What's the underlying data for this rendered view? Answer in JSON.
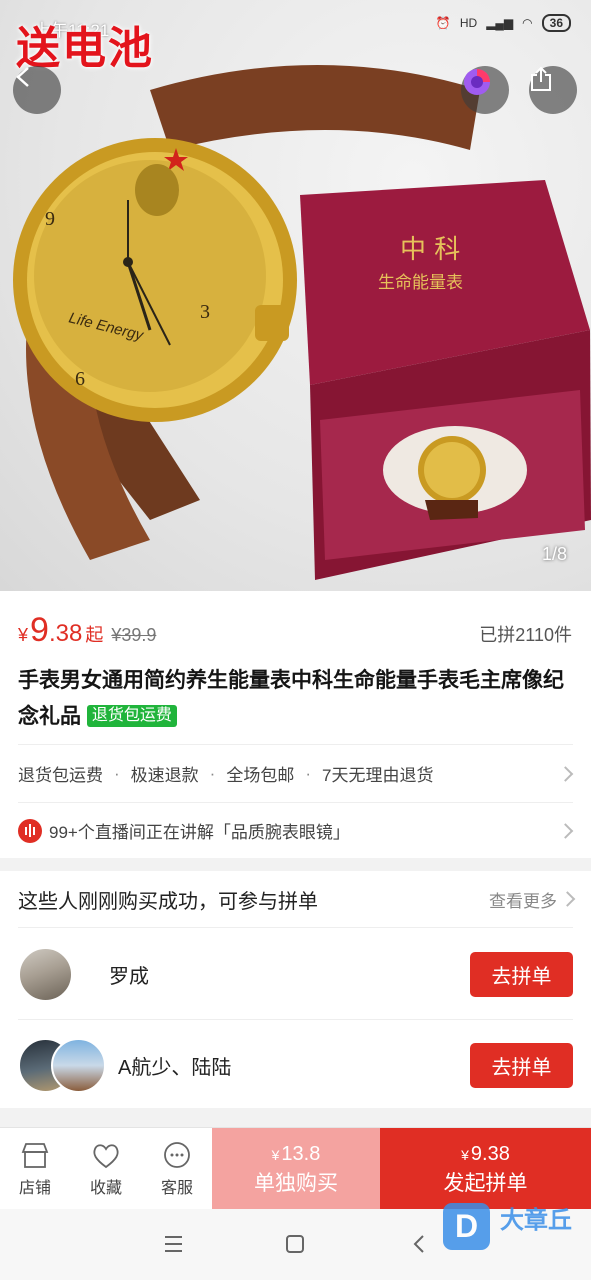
{
  "status_bar": {
    "time": "上午11:21",
    "battery": "36",
    "network": "HD"
  },
  "hero": {
    "promo_text": "送电池",
    "image_counter": "1/8",
    "dial_text": "Life Energy",
    "box_line1": "中 科",
    "box_line2": "生命能量表"
  },
  "product": {
    "currency": "¥",
    "price_int": "9",
    "price_dec": ".38",
    "price_suffix": "起",
    "original_price": "¥39.9",
    "sold_count": "已拼2110件",
    "title": "手表男女通用简约养生能量表中科生命能量手表毛主席像纪念礼品",
    "title_tag": "退货包运费"
  },
  "services": {
    "items": [
      "退货包运费",
      "极速退款",
      "全场包邮",
      "7天无理由退货"
    ],
    "separator": "·"
  },
  "live": {
    "text": "99+个直播间正在讲解「品质腕表眼镜」"
  },
  "group_buy": {
    "title": "这些人刚刚购买成功，可参与拼单",
    "see_more": "查看更多",
    "rows": [
      {
        "name": "罗成",
        "button": "去拼单"
      },
      {
        "name": "A航少、陆陆",
        "button": "去拼单"
      }
    ]
  },
  "bottom_bar": {
    "store": "店铺",
    "favorite": "收藏",
    "service": "客服",
    "buy_alone": {
      "currency": "¥",
      "price": "13.8",
      "label": "单独购买"
    },
    "buy_group": {
      "currency": "¥",
      "price": "9.38",
      "label": "发起拼单"
    }
  },
  "watermark": {
    "logo_letter": "D",
    "text": "大章丘"
  },
  "colors": {
    "accent": "#e02e24",
    "accent_light": "#f4a3a0",
    "tag_green": "#20b43b"
  }
}
